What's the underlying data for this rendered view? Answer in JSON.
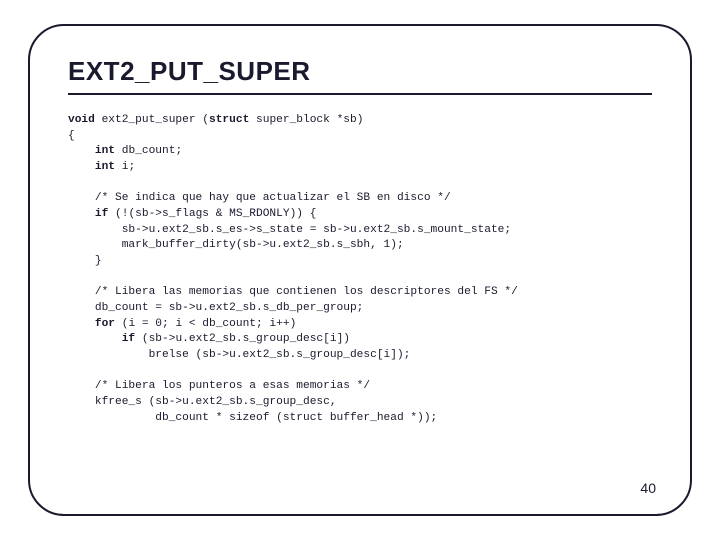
{
  "slide": {
    "title": "EXT2_PUT_SUPER",
    "page_number": "40",
    "code": {
      "l01a": "void",
      "l01b": " ext2_put_super (",
      "l01c": "struct",
      "l01d": " super_block *sb)",
      "l02": "{",
      "l03a": "    ",
      "l03b": "int",
      "l03c": " db_count;",
      "l04a": "    ",
      "l04b": "int",
      "l04c": " i;",
      "blank1": "",
      "l05": "    /* Se indica que hay que actualizar el SB en disco */",
      "l06a": "    ",
      "l06b": "if",
      "l06c": " (!(sb->s_flags & MS_RDONLY)) {",
      "l07": "        sb->u.ext2_sb.s_es->s_state = sb->u.ext2_sb.s_mount_state;",
      "l08": "        mark_buffer_dirty(sb->u.ext2_sb.s_sbh, 1);",
      "l09": "    }",
      "blank2": "",
      "l10": "    /* Libera las memorias que contienen los descriptores del FS */",
      "l11": "    db_count = sb->u.ext2_sb.s_db_per_group;",
      "l12a": "    ",
      "l12b": "for",
      "l12c": " (i = 0; i < db_count; i++)",
      "l13a": "        ",
      "l13b": "if",
      "l13c": " (sb->u.ext2_sb.s_group_desc[i])",
      "l14": "            brelse (sb->u.ext2_sb.s_group_desc[i]);",
      "blank3": "",
      "l15": "    /* Libera los punteros a esas memorias */",
      "l16": "    kfree_s (sb->u.ext2_sb.s_group_desc,",
      "l17": "             db_count * sizeof (struct buffer_head *));"
    }
  }
}
